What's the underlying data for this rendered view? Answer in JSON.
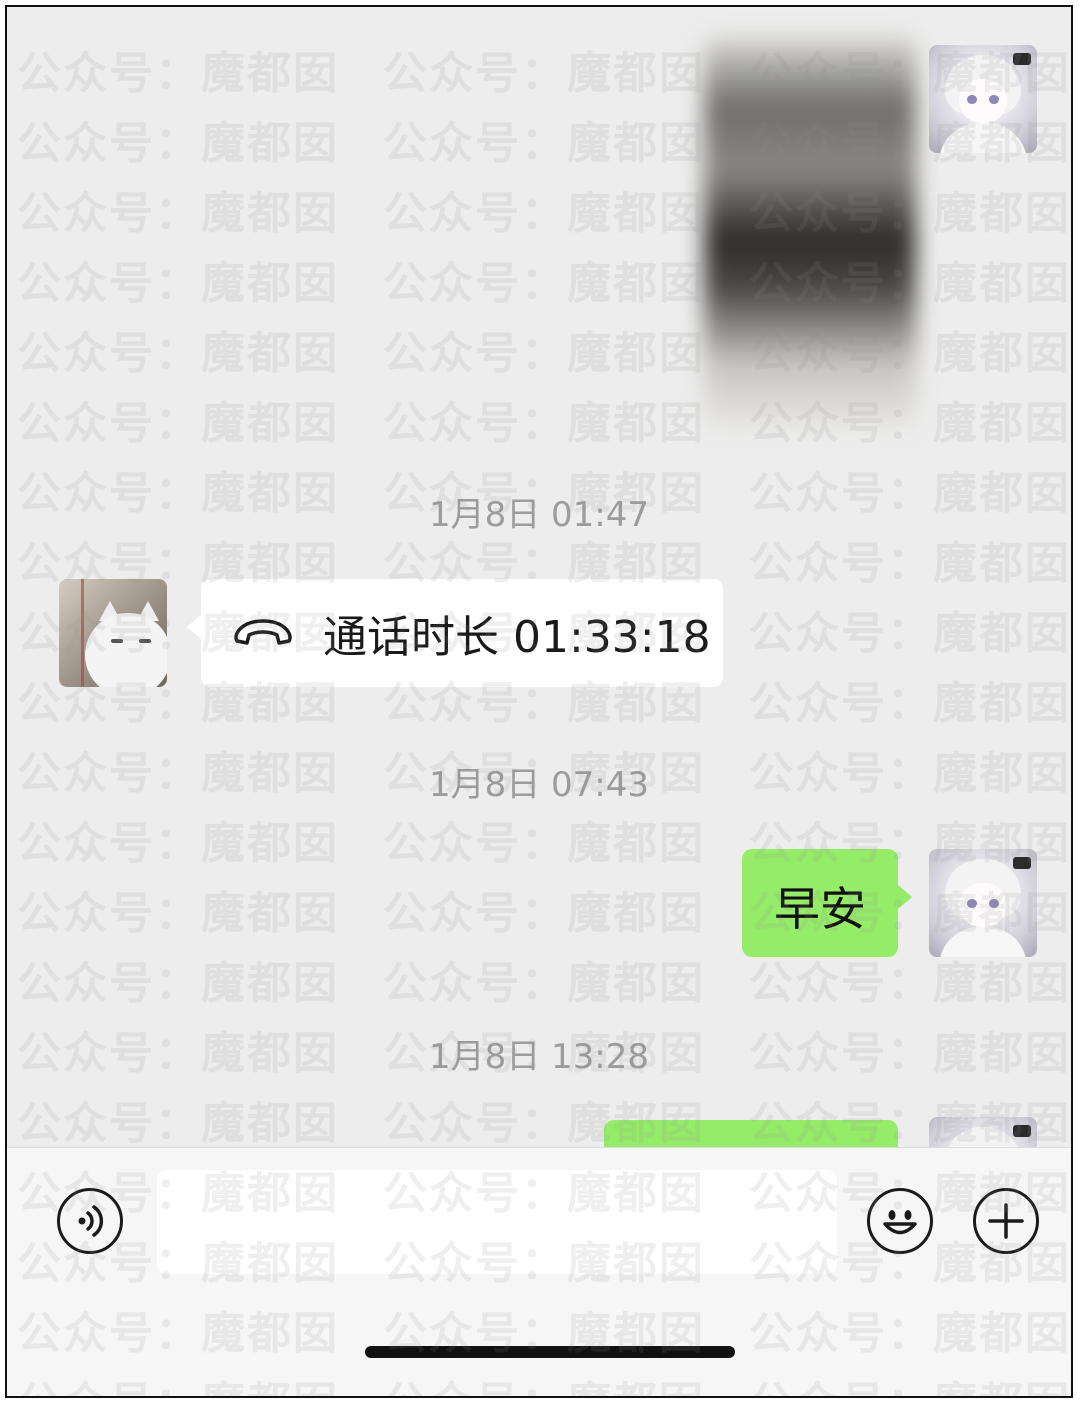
{
  "chat": {
    "messages": [
      {
        "type": "image",
        "sender": "self",
        "avatar": "doll-avatar",
        "content": "blurred-photo"
      },
      {
        "type": "timestamp",
        "text": "1月8日 01:47"
      },
      {
        "type": "call",
        "sender": "other",
        "avatar": "cat-avatar",
        "icon": "phone-hangup-icon",
        "text": "通话时长 01:33:18"
      },
      {
        "type": "timestamp",
        "text": "1月8日 07:43"
      },
      {
        "type": "text",
        "sender": "self",
        "avatar": "doll-avatar",
        "text": "早安"
      },
      {
        "type": "timestamp",
        "text": "1月8日 13:28"
      },
      {
        "type": "text",
        "sender": "self",
        "avatar": "doll-avatar",
        "text": "",
        "partially_visible": true
      }
    ]
  },
  "input_bar": {
    "voice_icon": "voice-icon",
    "text_value": "",
    "emoji_icon": "emoji-icon",
    "plus_icon": "plus-icon"
  },
  "watermark": {
    "text": "公众号：魔都囡"
  },
  "colors": {
    "background": "#ededed",
    "self_bubble": "#95ec69",
    "other_bubble": "#ffffff",
    "timestamp_text": "#9c9c9c"
  }
}
